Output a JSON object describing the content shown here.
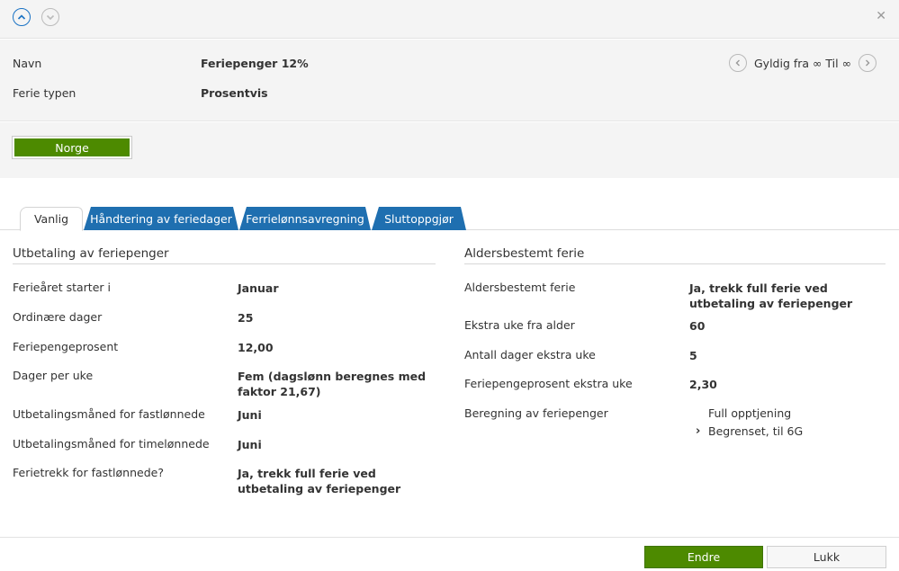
{
  "header": {
    "name_label": "Navn",
    "name_value": "Feriepenger 12%",
    "type_label": "Ferie typen",
    "type_value": "Prosentvis",
    "validity": "Gyldig fra ∞ Til ∞"
  },
  "country": {
    "label": "Norge"
  },
  "tabs": [
    {
      "label": "Vanlig"
    },
    {
      "label": "Håndtering av feriedager"
    },
    {
      "label": "Ferrielønnsavregning"
    },
    {
      "label": "Sluttoppgjør"
    }
  ],
  "left": {
    "title": "Utbetaling av feriepenger",
    "fields": [
      {
        "label": "Ferieåret starter i",
        "value": "Januar"
      },
      {
        "label": "Ordinære dager",
        "value": "25"
      },
      {
        "label": "Feriepengeprosent",
        "value": "12,00"
      },
      {
        "label": "Dager per uke",
        "value": "Fem (dagslønn beregnes med faktor 21,67)"
      },
      {
        "label": "Utbetalingsmåned for fastlønnede",
        "value": "Juni"
      },
      {
        "label": "Utbetalingsmåned for timelønnede",
        "value": "Juni"
      },
      {
        "label": "Ferietrekk for fastlønnede?",
        "value": "Ja, trekk full ferie ved utbetaling av feriepenger"
      }
    ]
  },
  "right": {
    "title": "Aldersbestemt ferie",
    "fields": [
      {
        "label": "Aldersbestemt ferie",
        "value": "Ja, trekk full ferie ved utbetaling av feriepenger"
      },
      {
        "label": "Ekstra uke fra alder",
        "value": "60"
      },
      {
        "label": "Antall dager ekstra uke",
        "value": "5"
      },
      {
        "label": "Feriepengeprosent ekstra uke",
        "value": "2,30"
      }
    ],
    "calc_label": "Beregning av feriepenger",
    "calc_options": [
      {
        "label": "Full opptjening",
        "selected": false
      },
      {
        "label": "Begrenset, til 6G",
        "selected": true
      }
    ]
  },
  "footer": {
    "edit_label": "Endre",
    "close_label": "Lukk"
  },
  "colors": {
    "accent_blue": "#1f6fb0",
    "brand_green": "#4d8a00"
  }
}
